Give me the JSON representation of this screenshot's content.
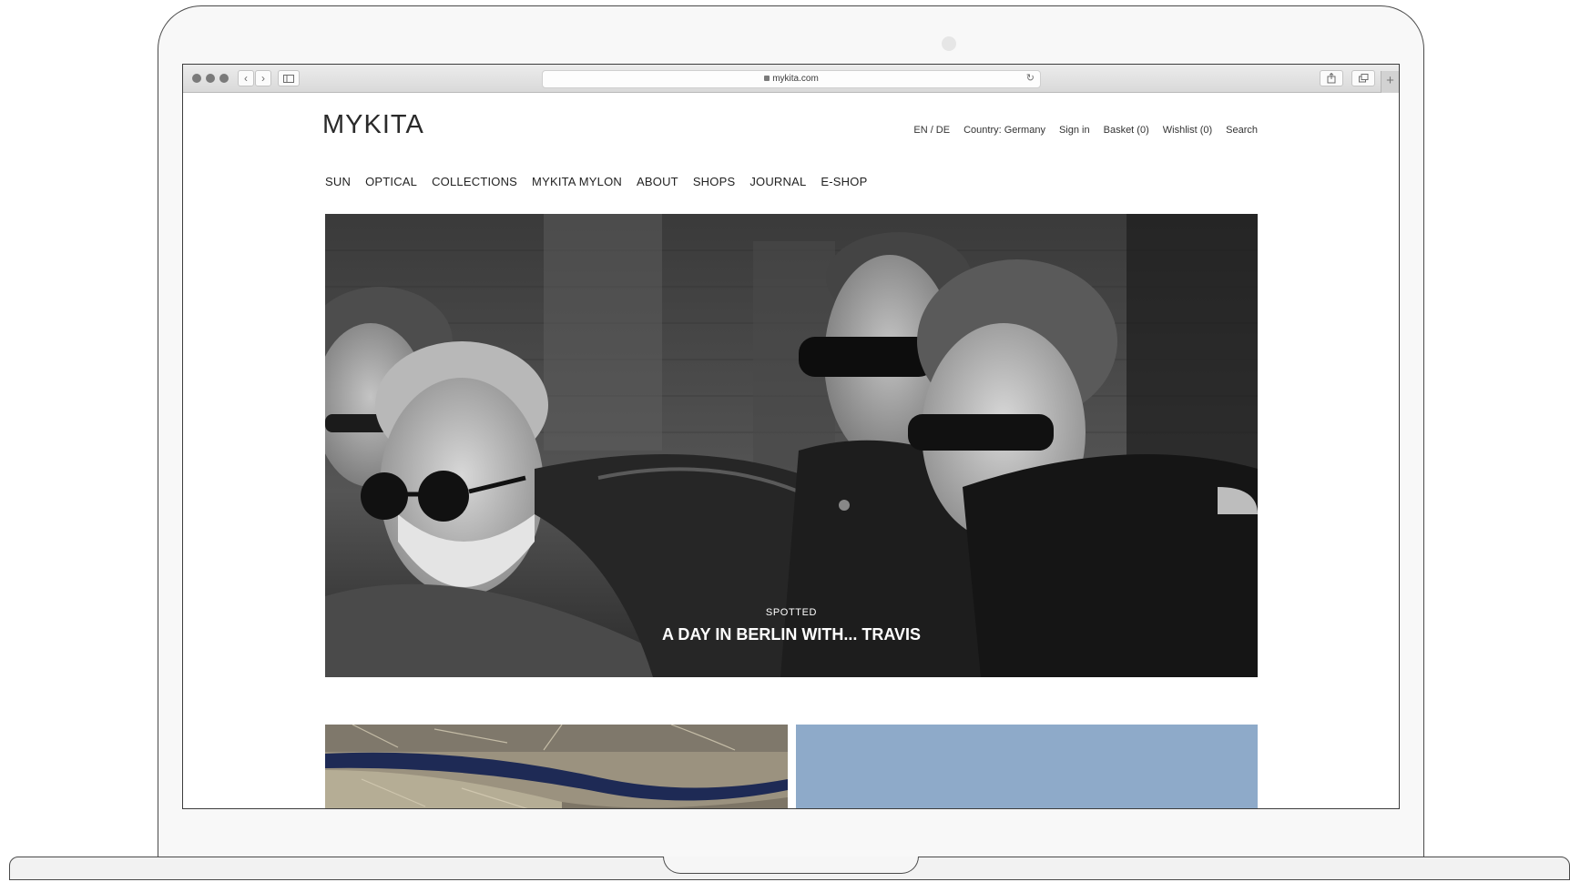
{
  "browser": {
    "url": "mykita.com"
  },
  "site": {
    "logo": "MYKITA",
    "utility_nav": [
      "EN / DE",
      "Country: Germany",
      "Sign in",
      "Basket (0)",
      "Wishlist (0)",
      "Search"
    ],
    "main_nav": [
      "SUN",
      "OPTICAL",
      "COLLECTIONS",
      "MYKITA MYLON",
      "ABOUT",
      "SHOPS",
      "JOURNAL",
      "E-SHOP"
    ]
  },
  "hero": {
    "kicker": "SPOTTED",
    "title": "A DAY IN BERLIN WITH... TRAVIS"
  },
  "colors": {
    "hero_tone": "#2b2b2b",
    "tile_sky": "#8eaac9"
  }
}
